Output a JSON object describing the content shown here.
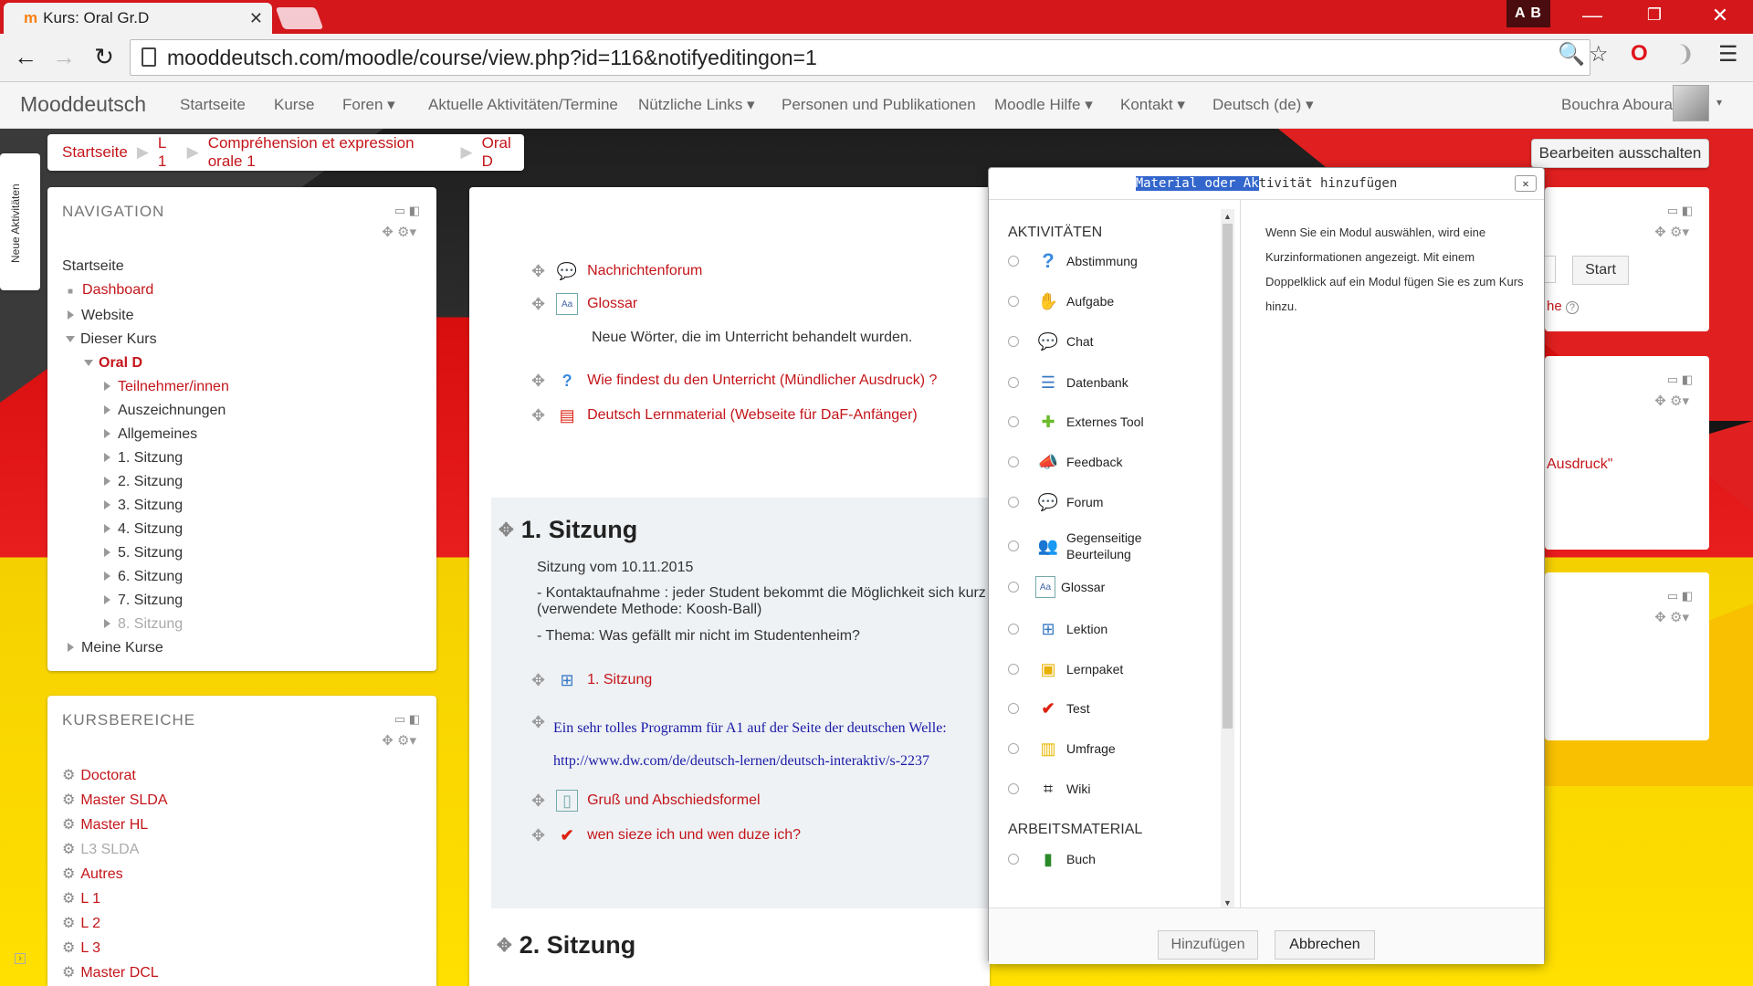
{
  "browser": {
    "tab_title": "Kurs: Oral Gr.D",
    "tab_icon": "m",
    "profile_initials": "A B",
    "url": "mooddeutsch.com/moodle/course/view.php?id=116&notifyeditingon=1"
  },
  "navbar": {
    "brand": "Mooddeutsch",
    "items": [
      "Startseite",
      "Kurse",
      "Foren ▾",
      "Aktuelle Aktivitäten/Termine",
      "Nützliche Links ▾",
      "Personen und Publikationen",
      "Moodle Hilfe ▾",
      "Kontakt ▾",
      "Deutsch (de) ▾"
    ],
    "user": "Bouchra Aboura"
  },
  "breadcrumb": [
    "Startseite",
    "L 1",
    "Compréhension et expression orale 1",
    "Oral D"
  ],
  "edit_button": "Bearbeiten ausschalten",
  "side_tab": "Neue Aktivitäten",
  "navigation": {
    "title": "NAVIGATION",
    "home": "Startseite",
    "dashboard": "Dashboard",
    "website": "Website",
    "dieser_kurs": "Dieser Kurs",
    "oral_d": "Oral D",
    "teilnehmer": "Teilnehmer/innen",
    "children": [
      "Auszeichnungen",
      "Allgemeines",
      "1. Sitzung",
      "2. Sitzung",
      "3. Sitzung",
      "4. Sitzung",
      "5. Sitzung",
      "6. Sitzung",
      "7. Sitzung"
    ],
    "hidden_child": "8. Sitzung",
    "meine_kurse": "Meine Kurse"
  },
  "kursbereiche": {
    "title": "KURSBEREICHE",
    "items": [
      {
        "label": "Doctorat",
        "dim": false
      },
      {
        "label": "Master SLDA",
        "dim": false
      },
      {
        "label": "Master HL",
        "dim": false
      },
      {
        "label": "L3 SLDA",
        "dim": true
      },
      {
        "label": "Autres",
        "dim": false
      },
      {
        "label": "L 1",
        "dim": false
      },
      {
        "label": "L 2",
        "dim": false
      },
      {
        "label": "L 3",
        "dim": false
      },
      {
        "label": "Master DCL",
        "dim": false
      }
    ]
  },
  "main": {
    "general_activities": {
      "forum": "Nachrichtenforum",
      "glossar": "Glossar",
      "glossar_desc": "Neue Wörter, die im Unterricht behandelt wurden.",
      "feedback": "Wie findest du den Unterricht (Mündlicher Ausdruck) ?",
      "material": "Deutsch Lernmaterial (Webseite für DaF-Anfänger)"
    },
    "section1": {
      "title": "1. Sitzung",
      "date": "Sitzung vom 10.11.2015",
      "line1": "- Kontaktaufnahme : jeder Student bekommt die Möglichkeit sich kurz v",
      "line1b": "(verwendete Methode: Koosh-Ball)",
      "line2": "- Thema: Was gefällt mir nicht im Studentenheim?",
      "lesson": "1. Sitzung",
      "dw_text": "Ein sehr tolles Programm für A1 auf der Seite der deutschen Welle:",
      "dw_url": "http://www.dw.com/de/deutsch-lernen/deutsch-interaktiv/s-2237",
      "gruss": "Gruß und Abschiedsformel",
      "quiz": "wen sieze ich und wen duze ich?"
    },
    "section2": {
      "title": "2. Sitzung"
    }
  },
  "right": {
    "start_button": "Start",
    "partial_text": "he",
    "partial_text2": "Ausdruck\""
  },
  "modal": {
    "title_highlight": "Material oder Ak",
    "title_rest": "tivität hinzufügen",
    "close": "✕",
    "cat_activities": "AKTIVITÄTEN",
    "activities": [
      {
        "label": "Abstimmung",
        "icon": "question-icon"
      },
      {
        "label": "Aufgabe",
        "icon": "assignment-icon"
      },
      {
        "label": "Chat",
        "icon": "chat-icon"
      },
      {
        "label": "Datenbank",
        "icon": "database-icon"
      },
      {
        "label": "Externes Tool",
        "icon": "puzzle-icon"
      },
      {
        "label": "Feedback",
        "icon": "megaphone-icon"
      },
      {
        "label": "Forum",
        "icon": "forum-icon"
      },
      {
        "label": "Gegenseitige",
        "label2": "Beurteilung",
        "icon": "people-icon"
      },
      {
        "label": "Glossar",
        "icon": "glossary-icon"
      },
      {
        "label": "Lektion",
        "icon": "lesson-icon"
      },
      {
        "label": "Lernpaket",
        "icon": "package-icon"
      },
      {
        "label": "Test",
        "icon": "checkmark-icon"
      },
      {
        "label": "Umfrage",
        "icon": "chart-icon"
      },
      {
        "label": "Wiki",
        "icon": "wiki-icon"
      }
    ],
    "cat_material": "ARBEITSMATERIAL",
    "material": [
      {
        "label": "Buch",
        "icon": "book-icon"
      }
    ],
    "description": "Wenn Sie ein Modul auswählen, wird eine Kurzinformationen angezeigt. Mit einem Doppelklick auf ein Modul fügen Sie es zum Kurs hinzu.",
    "add_button": "Hinzufügen",
    "cancel_button": "Abbrechen"
  },
  "colors": {
    "link": "#c4151a",
    "chrome": "#d3171b",
    "dw_link": "#1a1aa6"
  }
}
